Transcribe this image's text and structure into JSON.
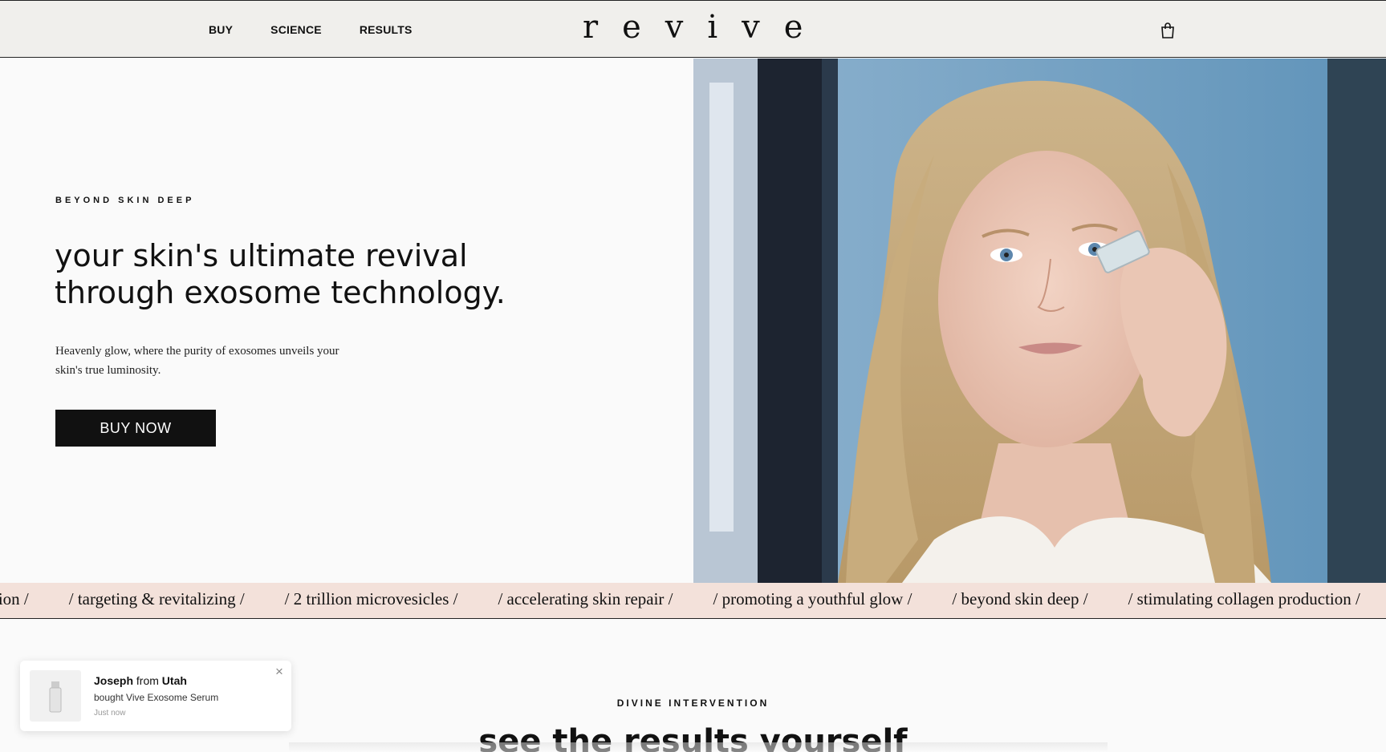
{
  "header": {
    "nav": [
      "BUY",
      "SCIENCE",
      "RESULTS"
    ],
    "logo": "revive",
    "cart_icon": "shopping-bag-icon"
  },
  "hero": {
    "eyebrow": "BEYOND SKIN DEEP",
    "headline_line1": "your skin's ultimate revival",
    "headline_line2": "through exosome technology.",
    "subtext_line1": "Heavenly glow, where the purity of exosomes unveils your",
    "subtext_line2": "skin's true luminosity.",
    "cta": "BUY NOW"
  },
  "marquee": {
    "items": [
      "tion /",
      "/ targeting & revitalizing /",
      "/ 2 trillion microvesicles /",
      "/ accelerating skin repair /",
      "/ promoting a youthful glow /",
      "/ beyond skin deep /",
      "/ stimulating collagen production /"
    ]
  },
  "results": {
    "eyebrow": "DIVINE INTERVENTION",
    "title": "see the results yourself"
  },
  "toast": {
    "name": "Joseph",
    "from": "from",
    "location": "Utah",
    "product": "bought Vive Exosome Serum",
    "time": "Just now",
    "close": "×"
  },
  "colors": {
    "header_bg": "#f0efec",
    "marquee_bg": "#f3e1da",
    "button_bg": "#111111"
  }
}
